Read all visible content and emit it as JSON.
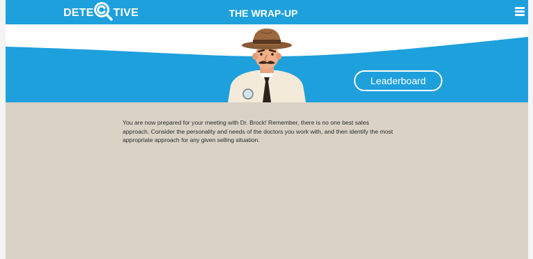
{
  "header": {
    "logo_text_left": "DETE",
    "logo_text_right": "TIVE",
    "title": "THE WRAP-UP",
    "menu_icon": "hamburger-menu-icon"
  },
  "banner": {
    "leaderboard_label": "Leaderboard",
    "character": "detective-character"
  },
  "main": {
    "message": "You are now prepared for your meeting with Dr. Brock! Remember, there is no one best sales approach. Consider the personality and needs of the doctors you work with, and then identify the most appropriate approach for any given selling situation."
  },
  "colors": {
    "brand_blue": "#1ea0dd",
    "page_background": "#d9d2c5",
    "banner_white": "#ffffff"
  }
}
